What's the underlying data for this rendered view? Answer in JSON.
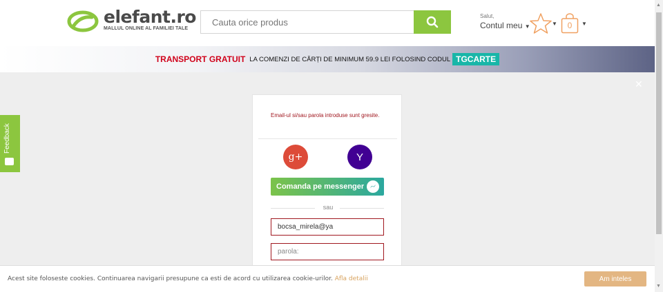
{
  "header": {
    "logo_name": "elefant.ro",
    "logo_tagline": "MALLUL ONLINE AL FAMILIEI TALE",
    "search_placeholder": "Cauta orice produs",
    "greeting": "Salut,",
    "account_label": "Contul meu",
    "cart_count": "0"
  },
  "promo": {
    "highlight": "TRANSPORT GRATUIT",
    "text": "LA COMENZI DE CĂRȚI DE MINIMUM 59.9 LEI FOLOSIND CODUL",
    "code": "TGCARTE"
  },
  "feedback": {
    "label": "Feedback"
  },
  "login": {
    "error": "Email-ul si/sau parola introduse sunt gresite.",
    "google_label": "g+",
    "yahoo_label": "Y",
    "messenger_label": "Comanda pe messenger",
    "separator": "sau",
    "email_value": "bocsa_mirela@ya",
    "password_placeholder": "parola:"
  },
  "cookie": {
    "text": "Acest site foloseste cookies. Continuarea navigarii presupune ca esti de acord cu utilizarea cookie-urilor.",
    "link": "Afla detalii",
    "button": "Am inteles"
  },
  "colors": {
    "brand_green": "#8cc63f",
    "error_red": "#a0161e",
    "promo_red": "#d0021b",
    "promo_code": "#18b6a8",
    "cookie_button": "#e3b682"
  },
  "icons": [
    "search-icon",
    "star-icon",
    "shopping-bag-icon",
    "chat-icon",
    "messenger-icon",
    "close-icon"
  ]
}
